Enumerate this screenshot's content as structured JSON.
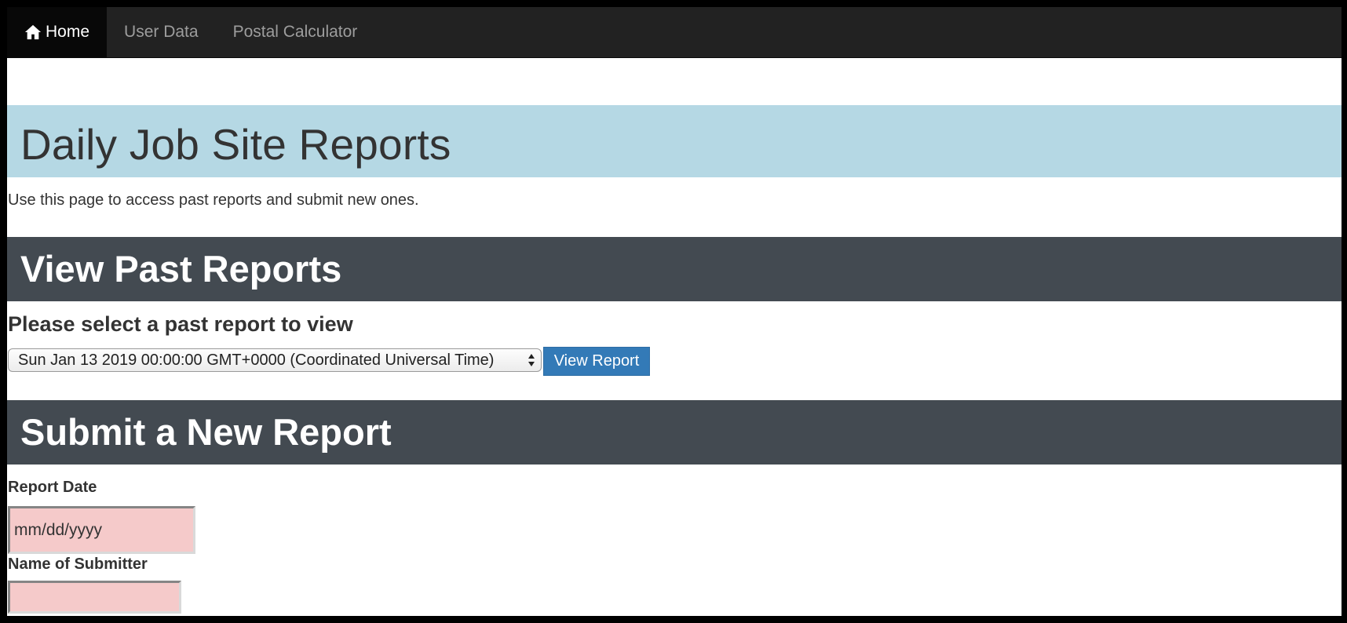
{
  "navbar": {
    "items": [
      {
        "label": "Home",
        "icon": "home-icon",
        "active": true
      },
      {
        "label": "User Data",
        "active": false
      },
      {
        "label": "Postal Calculator",
        "active": false
      }
    ]
  },
  "jumbotron": {
    "title": "Daily Job Site Reports"
  },
  "intro": "Use this page to access past reports and submit new ones.",
  "past_reports": {
    "heading": "View Past Reports",
    "prompt": "Please select a past report to view",
    "selected_report": "Sun Jan 13 2019 00:00:00 GMT+0000 (Coordinated Universal Time)",
    "view_button": "View Report"
  },
  "new_report": {
    "heading": "Submit a New Report",
    "report_date_label": "Report Date",
    "report_date_placeholder": "mm/dd/yyyy",
    "submitter_label": "Name of Submitter",
    "submitter_value": ""
  },
  "colors": {
    "navbar_bg": "#222222",
    "jumbotron_bg": "#b5d8e4",
    "section_bar_bg": "#434a51",
    "primary_button": "#337ab7",
    "invalid_input_bg": "#f5caca"
  }
}
